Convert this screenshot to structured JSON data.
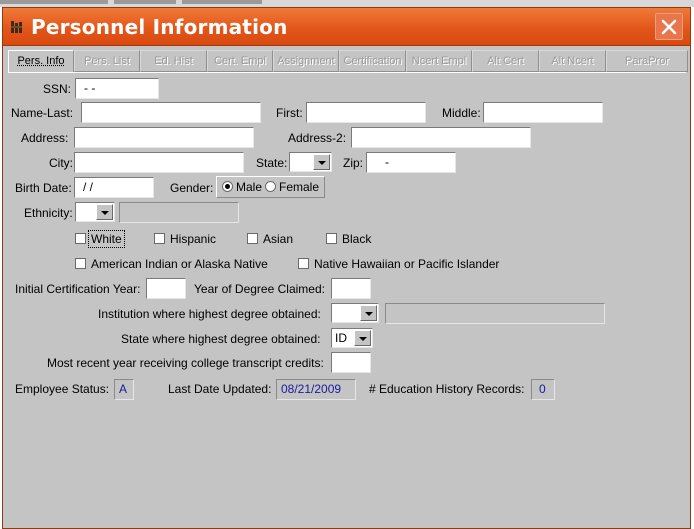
{
  "window": {
    "title": "Personnel Information"
  },
  "tabs": [
    {
      "label": "Pers. Info",
      "active": true
    },
    {
      "label": "Pers. List",
      "active": false
    },
    {
      "label": "Ed. Hist",
      "active": false
    },
    {
      "label": "Cert. Empl",
      "active": false
    },
    {
      "label": "Assignment",
      "active": false
    },
    {
      "label": "Certification",
      "active": false
    },
    {
      "label": "Ncert Empl",
      "active": false
    },
    {
      "label": "Alt Cert",
      "active": false
    },
    {
      "label": "Alt Ncert",
      "active": false
    },
    {
      "label": "ParaPror",
      "active": false
    }
  ],
  "form": {
    "ssn": {
      "label": "SSN:",
      "value": " - -"
    },
    "name_last": {
      "label": "Name-Last:",
      "value": ""
    },
    "first": {
      "label": "First:",
      "value": ""
    },
    "middle": {
      "label": "Middle:",
      "value": ""
    },
    "address": {
      "label": "Address:",
      "value": ""
    },
    "address2": {
      "label": "Address-2:",
      "value": ""
    },
    "city": {
      "label": "City:",
      "value": ""
    },
    "state": {
      "label": "State:",
      "value": ""
    },
    "zip": {
      "label": "Zip:",
      "value": "-"
    },
    "birth_date": {
      "label": "Birth Date:",
      "value": "/ /"
    },
    "gender": {
      "label": "Gender:",
      "options": [
        "Male",
        "Female"
      ],
      "selected": "Male"
    },
    "ethnicity": {
      "label": "Ethnicity:",
      "value": "",
      "description": ""
    },
    "race": [
      {
        "label": "White",
        "checked": false,
        "focused": true
      },
      {
        "label": "Hispanic",
        "checked": false
      },
      {
        "label": "Asian",
        "checked": false
      },
      {
        "label": "Black",
        "checked": false
      },
      {
        "label": "American Indian or Alaska Native",
        "checked": false
      },
      {
        "label": "Native Hawaiian or Pacific Islander",
        "checked": false
      }
    ],
    "initial_cert_year": {
      "label": "Initial Certification Year:",
      "value": ""
    },
    "year_degree_claimed": {
      "label": "Year of Degree Claimed:",
      "value": ""
    },
    "institution": {
      "label": "Institution where highest degree obtained:",
      "value": "",
      "name": ""
    },
    "state_degree": {
      "label": "State where highest degree obtained:",
      "value": "ID"
    },
    "recent_transcript_year": {
      "label": "Most recent year receiving college transcript credits:",
      "value": ""
    },
    "employee_status": {
      "label": "Employee Status:",
      "value": "A"
    },
    "last_updated": {
      "label": "Last Date Updated:",
      "value": "08/21/2009"
    },
    "edu_history_records": {
      "label": "# Education History Records:",
      "value": "0"
    }
  },
  "colors": {
    "titlebar": "#e3561a",
    "panel": "#c4c4c4",
    "readonly_text": "#1a1aa0"
  }
}
